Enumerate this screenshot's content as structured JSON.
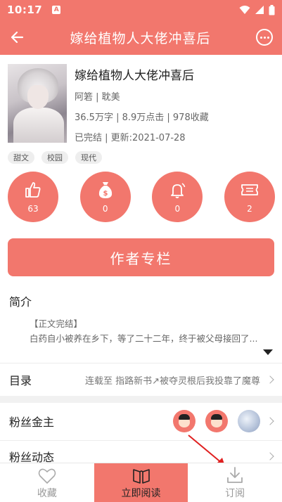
{
  "status_bar": {
    "time": "10:17",
    "notice_glyph": "A"
  },
  "header": {
    "title": "嫁给植物人大佬冲喜后"
  },
  "book": {
    "title": "嫁给植物人大佬冲喜后",
    "author_category": "阿箬 | 耽美",
    "stats_line": "36.5万字 | 8.9万点击 | 978收藏",
    "status_line": "已完结 | 更新:2021-07-28"
  },
  "tags": [
    "甜文",
    "校园",
    "现代"
  ],
  "stats": [
    {
      "icon": "thumbs-up-icon",
      "value": "63"
    },
    {
      "icon": "money-bag-icon",
      "value": "0"
    },
    {
      "icon": "bell-icon",
      "value": "0"
    },
    {
      "icon": "ticket-icon",
      "value": "2"
    }
  ],
  "author_button": {
    "label": "作者专栏"
  },
  "intro": {
    "heading": "简介",
    "line1": "【正文完结】",
    "line2": "白药自小被养在乡下，等了二十二年，终于被父母接回了..."
  },
  "catalog": {
    "label": "目录",
    "value": "连载至 指路新书↗被夺灵根后我投靠了魔尊"
  },
  "fans_gold": {
    "label": "粉丝金主"
  },
  "fans_activity": {
    "label": "粉丝动态"
  },
  "bottom_bar": {
    "favorite": "收藏",
    "read_now": "立即阅读",
    "subscribe": "订阅"
  },
  "colors": {
    "accent": "#f2776d",
    "annotation_arrow": "#e02020"
  }
}
